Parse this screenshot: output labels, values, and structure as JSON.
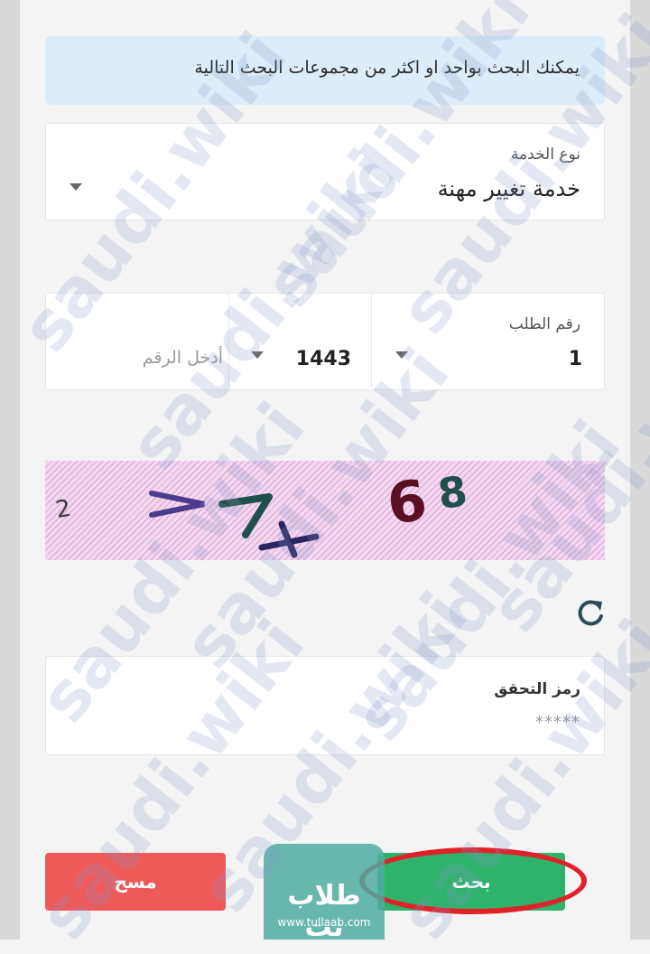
{
  "info": {
    "text": "يمكنك البحث بواحد او اكثر من مجموعات البحث التالية"
  },
  "service": {
    "label": "نوع الخدمة",
    "value": "خدمة تغيير مهنة"
  },
  "request": {
    "label": "رقم الطلب",
    "first_value": "1",
    "year_value": "1443",
    "number_placeholder": "أدخل الرقم"
  },
  "captcha": {
    "text": "2 >7+ 68"
  },
  "verification": {
    "label": "رمز التحقق",
    "value": "*****"
  },
  "buttons": {
    "search": "بحث",
    "clear": "مسح"
  },
  "logo": {
    "name": "طلاب نت",
    "url": "www.tullaab.com"
  },
  "watermark": {
    "text": "saudi.wiki"
  },
  "colors": {
    "info_bg": "#dcedf9",
    "search_button": "#2fb36b",
    "clear_button": "#ee5a5a",
    "highlight_ring": "#e0202a",
    "logo_bg": "#4faca0",
    "refresh_icon": "#2d4a57"
  }
}
